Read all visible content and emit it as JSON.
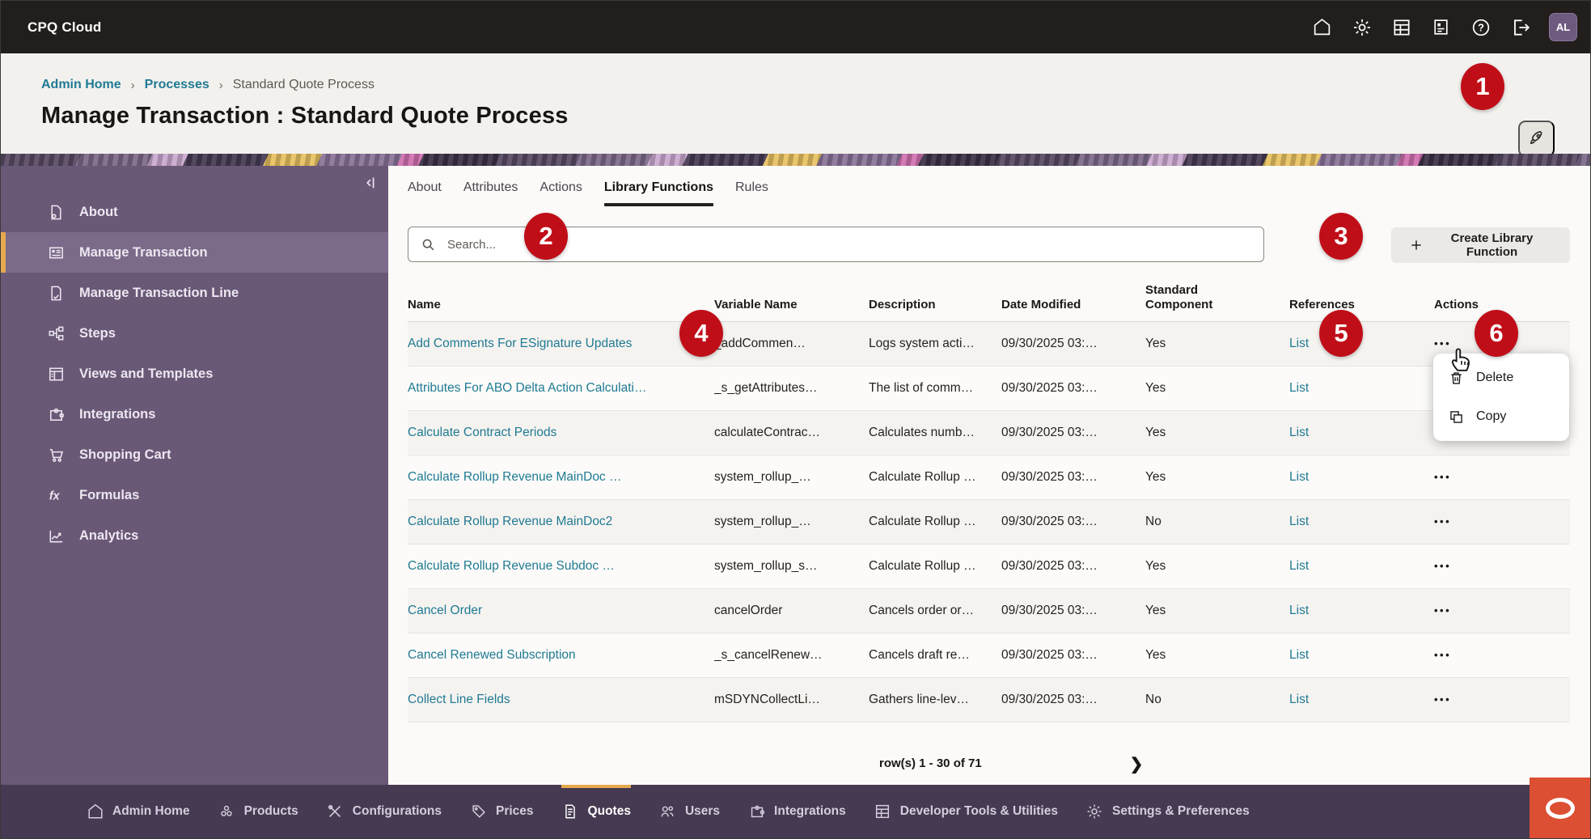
{
  "app": {
    "name": "CPQ Cloud",
    "avatar_initials": "AL"
  },
  "header": {
    "breadcrumb": [
      "Admin Home",
      "Processes",
      "Standard Quote Process"
    ],
    "breadcrumb_separator": "›",
    "title": "Manage Transaction : Standard Quote Process"
  },
  "callouts": {
    "c1": "1",
    "c2": "2",
    "c3": "3",
    "c4": "4",
    "c5": "5",
    "c6": "6"
  },
  "sidebar": {
    "items": [
      {
        "label": "About"
      },
      {
        "label": "Manage Transaction",
        "selected": true
      },
      {
        "label": "Manage Transaction Line"
      },
      {
        "label": "Steps"
      },
      {
        "label": "Views and Templates"
      },
      {
        "label": "Integrations"
      },
      {
        "label": "Shopping Cart"
      },
      {
        "label": "Formulas"
      },
      {
        "label": "Analytics"
      }
    ]
  },
  "tabs": [
    {
      "label": "About"
    },
    {
      "label": "Attributes"
    },
    {
      "label": "Actions"
    },
    {
      "label": "Library Functions",
      "active": true
    },
    {
      "label": "Rules"
    }
  ],
  "toolbar": {
    "search_placeholder": "Search...",
    "create_button": "Create Library Function"
  },
  "table": {
    "columns": [
      "Name",
      "Variable Name",
      "Description",
      "Date Modified",
      "Standard Component",
      "References",
      "Actions"
    ],
    "actions_glyph": "•••",
    "rows": [
      {
        "name": "Add Comments For ESignature Updates",
        "variable": "_addCommen…",
        "description": "Logs system acti…",
        "date": "09/30/2025 03:…",
        "standard": "Yes",
        "references": "List"
      },
      {
        "name": "Attributes For ABO Delta Action Calculati…",
        "variable": "_s_getAttributes…",
        "description": "The list of comm…",
        "date": "09/30/2025 03:…",
        "standard": "Yes",
        "references": "List"
      },
      {
        "name": "Calculate Contract Periods",
        "variable": "calculateContrac…",
        "description": "Calculates numb…",
        "date": "09/30/2025 03:…",
        "standard": "Yes",
        "references": "List"
      },
      {
        "name": "Calculate Rollup Revenue MainDoc …",
        "variable": "system_rollup_…",
        "description": "Calculate Rollup …",
        "date": "09/30/2025 03:…",
        "standard": "Yes",
        "references": "List"
      },
      {
        "name": "Calculate Rollup Revenue MainDoc2",
        "variable": "system_rollup_…",
        "description": "Calculate Rollup …",
        "date": "09/30/2025 03:…",
        "standard": "No",
        "references": "List"
      },
      {
        "name": "Calculate Rollup Revenue Subdoc …",
        "variable": "system_rollup_s…",
        "description": "Calculate Rollup …",
        "date": "09/30/2025 03:…",
        "standard": "Yes",
        "references": "List"
      },
      {
        "name": "Cancel Order",
        "variable": "cancelOrder",
        "description": "Cancels order or…",
        "date": "09/30/2025 03:…",
        "standard": "Yes",
        "references": "List"
      },
      {
        "name": "Cancel Renewed Subscription",
        "variable": "_s_cancelRenew…",
        "description": "Cancels draft re…",
        "date": "09/30/2025 03:…",
        "standard": "Yes",
        "references": "List"
      },
      {
        "name": "Collect Line Fields",
        "variable": "mSDYNCollectLi…",
        "description": "Gathers line-lev…",
        "date": "09/30/2025 03:…",
        "standard": "No",
        "references": "List"
      }
    ]
  },
  "context_menu": {
    "items": [
      {
        "label": "Delete"
      },
      {
        "label": "Copy"
      }
    ]
  },
  "pagination": {
    "label": "row(s) 1 - 30 of 71",
    "next_glyph": "❯"
  },
  "bottombar": {
    "items": [
      {
        "label": "Admin Home"
      },
      {
        "label": "Products"
      },
      {
        "label": "Configurations"
      },
      {
        "label": "Prices"
      },
      {
        "label": "Quotes",
        "active": true
      },
      {
        "label": "Users"
      },
      {
        "label": "Integrations"
      },
      {
        "label": "Developer Tools & Utilities"
      },
      {
        "label": "Settings & Preferences"
      }
    ]
  },
  "colors": {
    "callout_red": "#c00e18",
    "link_teal": "#1f7a93",
    "sidebar_purple": "#6a5877",
    "bottombar_purple": "#453a51",
    "highlight_yellow": "#e7a94e",
    "chat_orange": "#dc4f33"
  }
}
